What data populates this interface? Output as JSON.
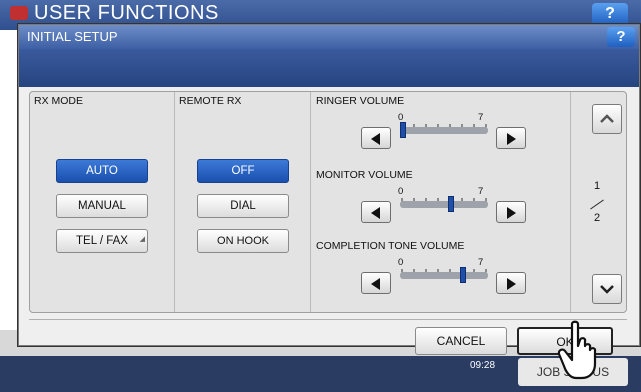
{
  "background": {
    "title": "USER FUNCTIONS",
    "help": "?",
    "time": "09:28",
    "job_button": "JOB STATUS"
  },
  "dialog": {
    "title": "INITIAL SETUP",
    "help": "?"
  },
  "rx_mode": {
    "label": "RX MODE",
    "options": [
      "AUTO",
      "MANUAL",
      "TEL / FAX"
    ],
    "selected": "AUTO"
  },
  "remote_rx": {
    "label": "REMOTE RX",
    "options": [
      "OFF",
      "DIAL",
      "ON HOOK"
    ],
    "selected": "OFF"
  },
  "volumes": [
    {
      "label": "RINGER VOLUME",
      "min": "0",
      "max": "7",
      "level": 0
    },
    {
      "label": "MONITOR VOLUME",
      "min": "0",
      "max": "7",
      "level": 4
    },
    {
      "label": "COMPLETION TONE VOLUME",
      "min": "0",
      "max": "7",
      "level": 5
    }
  ],
  "pager": {
    "current": "1",
    "total": "2"
  },
  "footer": {
    "cancel": "CANCEL",
    "ok": "OK"
  },
  "colors": {
    "accent": "#1a4fae",
    "header": "#3d5fa4"
  }
}
